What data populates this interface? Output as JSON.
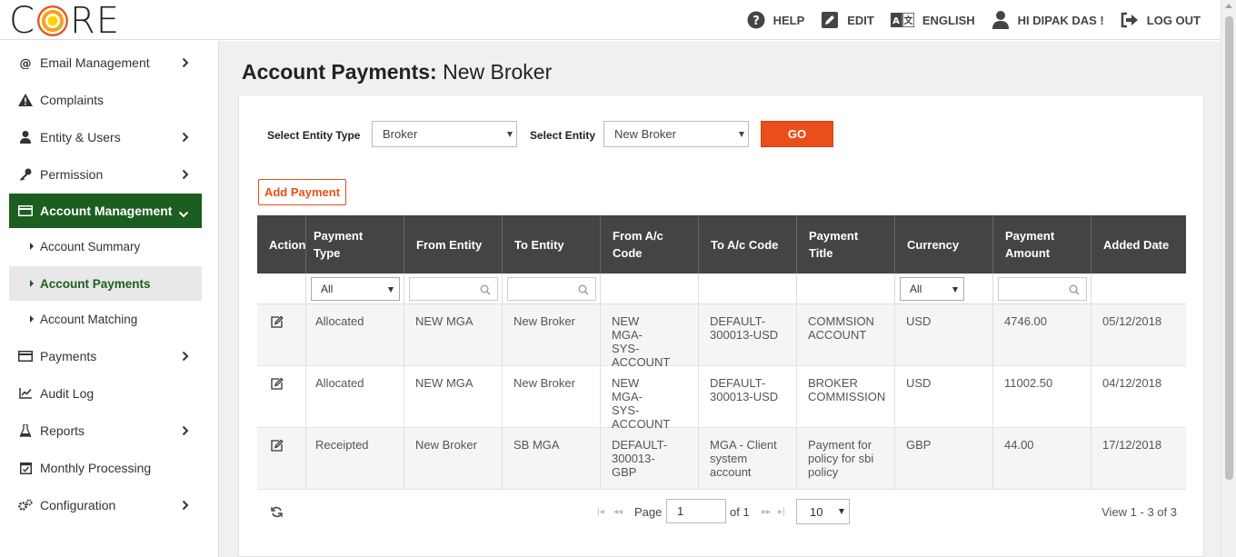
{
  "app": {
    "logo_text": "CORE",
    "colors": {
      "brand_green": "#1b5e20",
      "accent_orange": "#e94e1b",
      "grid_header": "#444444"
    }
  },
  "topnav": {
    "help": "HELP",
    "edit": "EDIT",
    "language": "ENGLISH",
    "user": "HI DIPAK DAS !",
    "logout": "LOG OUT"
  },
  "sidebar": {
    "items": [
      {
        "label": "Email Management",
        "icon": "at-icon",
        "has_chevron": true
      },
      {
        "label": "Complaints",
        "icon": "warning-icon",
        "has_chevron": false
      },
      {
        "label": "Entity & Users",
        "icon": "user-icon",
        "has_chevron": true
      },
      {
        "label": "Permission",
        "icon": "key-icon",
        "has_chevron": true
      },
      {
        "label": "Account Management",
        "icon": "card-icon",
        "has_chevron": true,
        "expanded": true
      },
      {
        "label": "Payments",
        "icon": "card-icon",
        "has_chevron": true
      },
      {
        "label": "Audit Log",
        "icon": "chart-icon",
        "has_chevron": false
      },
      {
        "label": "Reports",
        "icon": "flask-icon",
        "has_chevron": true
      },
      {
        "label": "Monthly Processing",
        "icon": "calendar-check-icon",
        "has_chevron": false
      },
      {
        "label": "Configuration",
        "icon": "cogs-icon",
        "has_chevron": true
      }
    ],
    "subitems": [
      {
        "label": "Account Summary"
      },
      {
        "label": "Account Payments",
        "current": true
      },
      {
        "label": "Account Matching"
      }
    ]
  },
  "page": {
    "title_bold": "Account Payments:",
    "title_rest": " New Broker"
  },
  "filters": {
    "entity_type_label": "Select Entity Type",
    "entity_type_value": "Broker",
    "entity_label": "Select Entity",
    "entity_value": "New Broker",
    "go_label": "GO",
    "add_payment_label": "Add Payment"
  },
  "grid": {
    "columns": [
      "Action",
      "Payment Type",
      "From Entity",
      "To Entity",
      "From A/c Code",
      "To A/c Code",
      "Payment Title",
      "Currency",
      "Payment Amount",
      "Added Date"
    ],
    "filter_payment_type": "All",
    "filter_currency": "All",
    "rows": [
      {
        "payment_type": "Allocated",
        "from_entity": "NEW MGA",
        "to_entity": "New Broker",
        "from_code": "NEW MGA-SYS-ACCOUNT",
        "to_code": "DEFAULT-300013-USD",
        "title": "COMMSION ACCOUNT",
        "currency": "USD",
        "amount": "4746.00",
        "date": "05/12/2018"
      },
      {
        "payment_type": "Allocated",
        "from_entity": "NEW MGA",
        "to_entity": "New Broker",
        "from_code": "NEW MGA-SYS-ACCOUNT",
        "to_code": "DEFAULT-300013-USD",
        "title": "BROKER COMMISSION",
        "currency": "USD",
        "amount": "11002.50",
        "date": "04/12/2018"
      },
      {
        "payment_type": "Receipted",
        "from_entity": "New Broker",
        "to_entity": "SB MGA",
        "from_code": "DEFAULT-300013-GBP",
        "to_code": "MGA - Client system account",
        "title": "Payment for policy for sbi policy",
        "currency": "GBP",
        "amount": "44.00",
        "date": "17/12/2018"
      }
    ]
  },
  "pager": {
    "page_label": "Page",
    "page_value": "1",
    "of_label": "of 1",
    "page_size": "10",
    "view_text": "View 1 - 3 of 3"
  }
}
